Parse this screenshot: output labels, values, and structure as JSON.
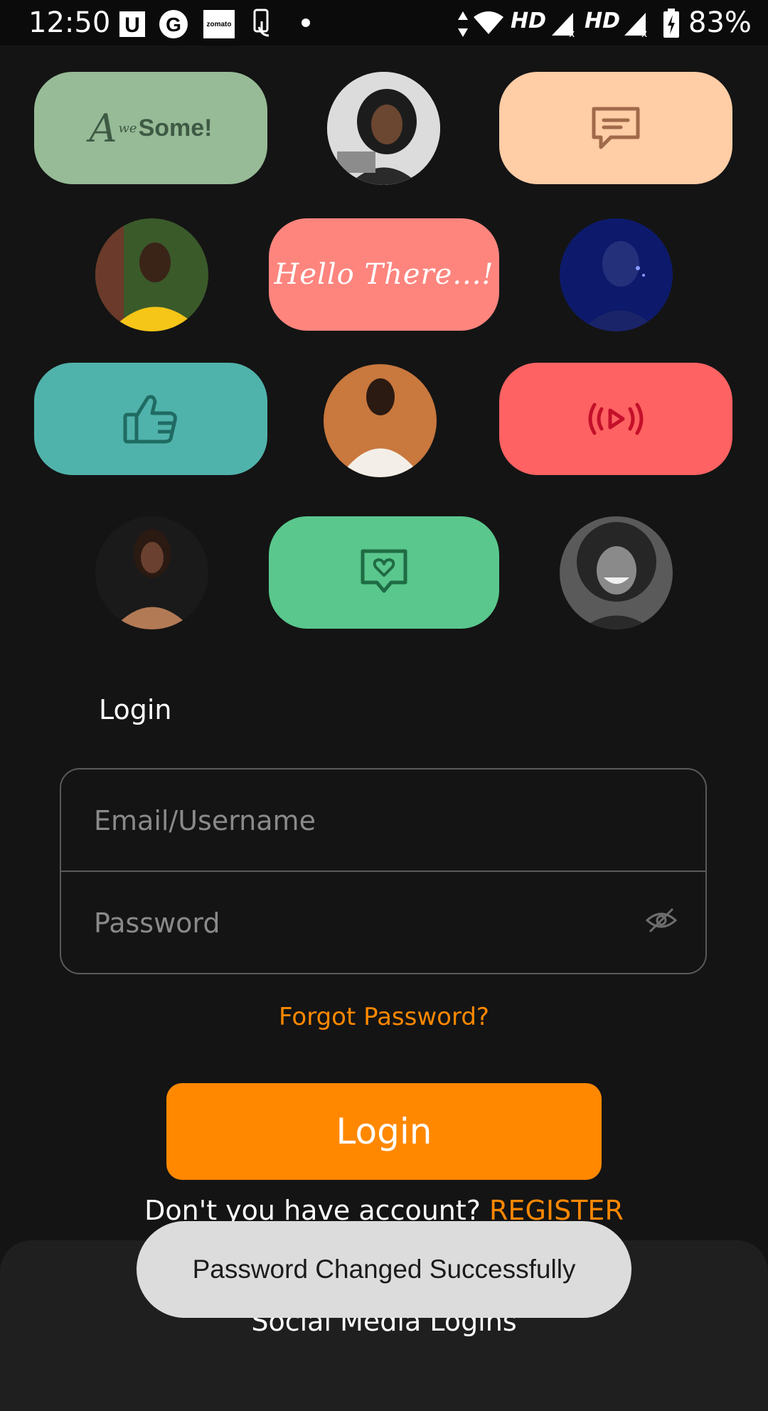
{
  "status_bar": {
    "time": "12:50",
    "network_label_1": "HD",
    "network_label_2": "HD",
    "battery": "83%",
    "notification_icons": [
      "u-app-icon",
      "google-icon",
      "zomato-icon",
      "touch-icon",
      "dot-icon"
    ],
    "zomato_text": "zomato"
  },
  "tiles": {
    "awesome_script": "A",
    "awesome_small": "we",
    "awesome_text": "Some!",
    "hello_text": "Hello There...!",
    "colors": {
      "sage": "#97bb97",
      "peach": "#ffcda6",
      "salmon": "#fd857e",
      "teal": "#50b3ab",
      "red": "#fe6262",
      "green": "#5ac78d",
      "orange": "#ff8800"
    }
  },
  "login": {
    "heading": "Login",
    "email_placeholder": "Email/Username",
    "password_placeholder": "Password",
    "forgot_password": "Forgot Password?",
    "login_button": "Login",
    "no_account_text": "Don't you have account? ",
    "register_link": "REGISTER"
  },
  "bottom_sheet": {
    "title": "Social Media Logins"
  },
  "toast": {
    "message": "Password Changed Successfully"
  }
}
